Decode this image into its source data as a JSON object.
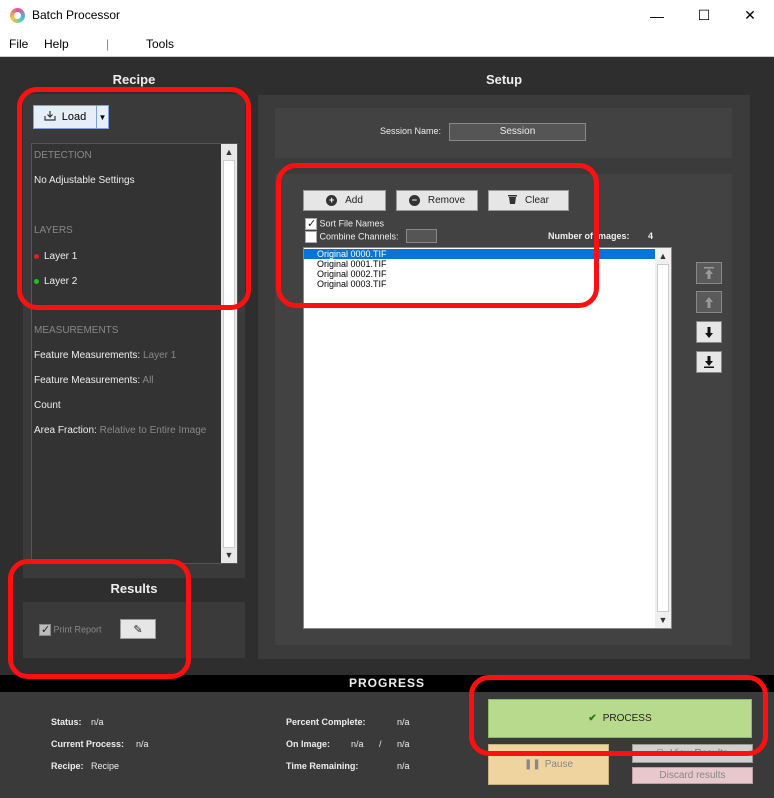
{
  "window": {
    "title": "Batch Processor",
    "minimize": "—",
    "maximize": "☐",
    "close": "✕"
  },
  "menu": [
    "File",
    "Help",
    "|",
    "Tools"
  ],
  "recipe": {
    "title": "Recipe",
    "load_label": "Load",
    "list": {
      "detection_header": "DETECTION",
      "detection_text": "No Adjustable Settings",
      "layers_header": "LAYERS",
      "layers": [
        {
          "label": "Layer 1",
          "color": "#e02020"
        },
        {
          "label": "Layer 2",
          "color": "#20c020"
        }
      ],
      "measurements_header": "MEASUREMENTS",
      "measurements": [
        {
          "label": "Feature Measurements:",
          "value": "Layer 1"
        },
        {
          "label": "Feature Measurements:",
          "value": "All"
        },
        {
          "label": "Count",
          "value": ""
        },
        {
          "label": "Area Fraction:",
          "value": "Relative to Entire Image"
        }
      ]
    }
  },
  "results": {
    "title": "Results",
    "print_report": "Print Report",
    "print_checked": true
  },
  "setup": {
    "title": "Setup",
    "session_label": "Session Name:",
    "session_value": "Session",
    "add_label": "Add",
    "remove_label": "Remove",
    "clear_label": "Clear",
    "sort_label": "Sort File Names",
    "sort_checked": true,
    "combine_label": "Combine Channels:",
    "combine_checked": false,
    "num_images_label": "Number of Images:",
    "num_images_value": "4",
    "files": [
      "Original 0000.TIF",
      "Original 0001.TIF",
      "Original 0002.TIF",
      "Original 0003.TIF"
    ],
    "selected_index": 0
  },
  "progress": {
    "title": "PROGRESS",
    "status_label": "Status:",
    "status_value": "n/a",
    "current_process_label": "Current Process:",
    "current_process_value": "n/a",
    "recipe_label": "Recipe:",
    "recipe_value": "Recipe",
    "percent_label": "Percent Complete:",
    "percent_value": "n/a",
    "on_image_label": "On Image:",
    "on_image_value": "n/a",
    "on_image_sep": "/",
    "on_image_total": "n/a",
    "time_label": "Time Remaining:",
    "time_value": "n/a",
    "process_label": "PROCESS",
    "pause_label": "Pause",
    "view_results_label": "View Results",
    "discard_label": "Discard results"
  },
  "colors": {
    "highlight": "#ff1010",
    "process_bg": "#b8da8c",
    "pause_bg": "#f0d4a0",
    "selection": "#0a74d6"
  }
}
